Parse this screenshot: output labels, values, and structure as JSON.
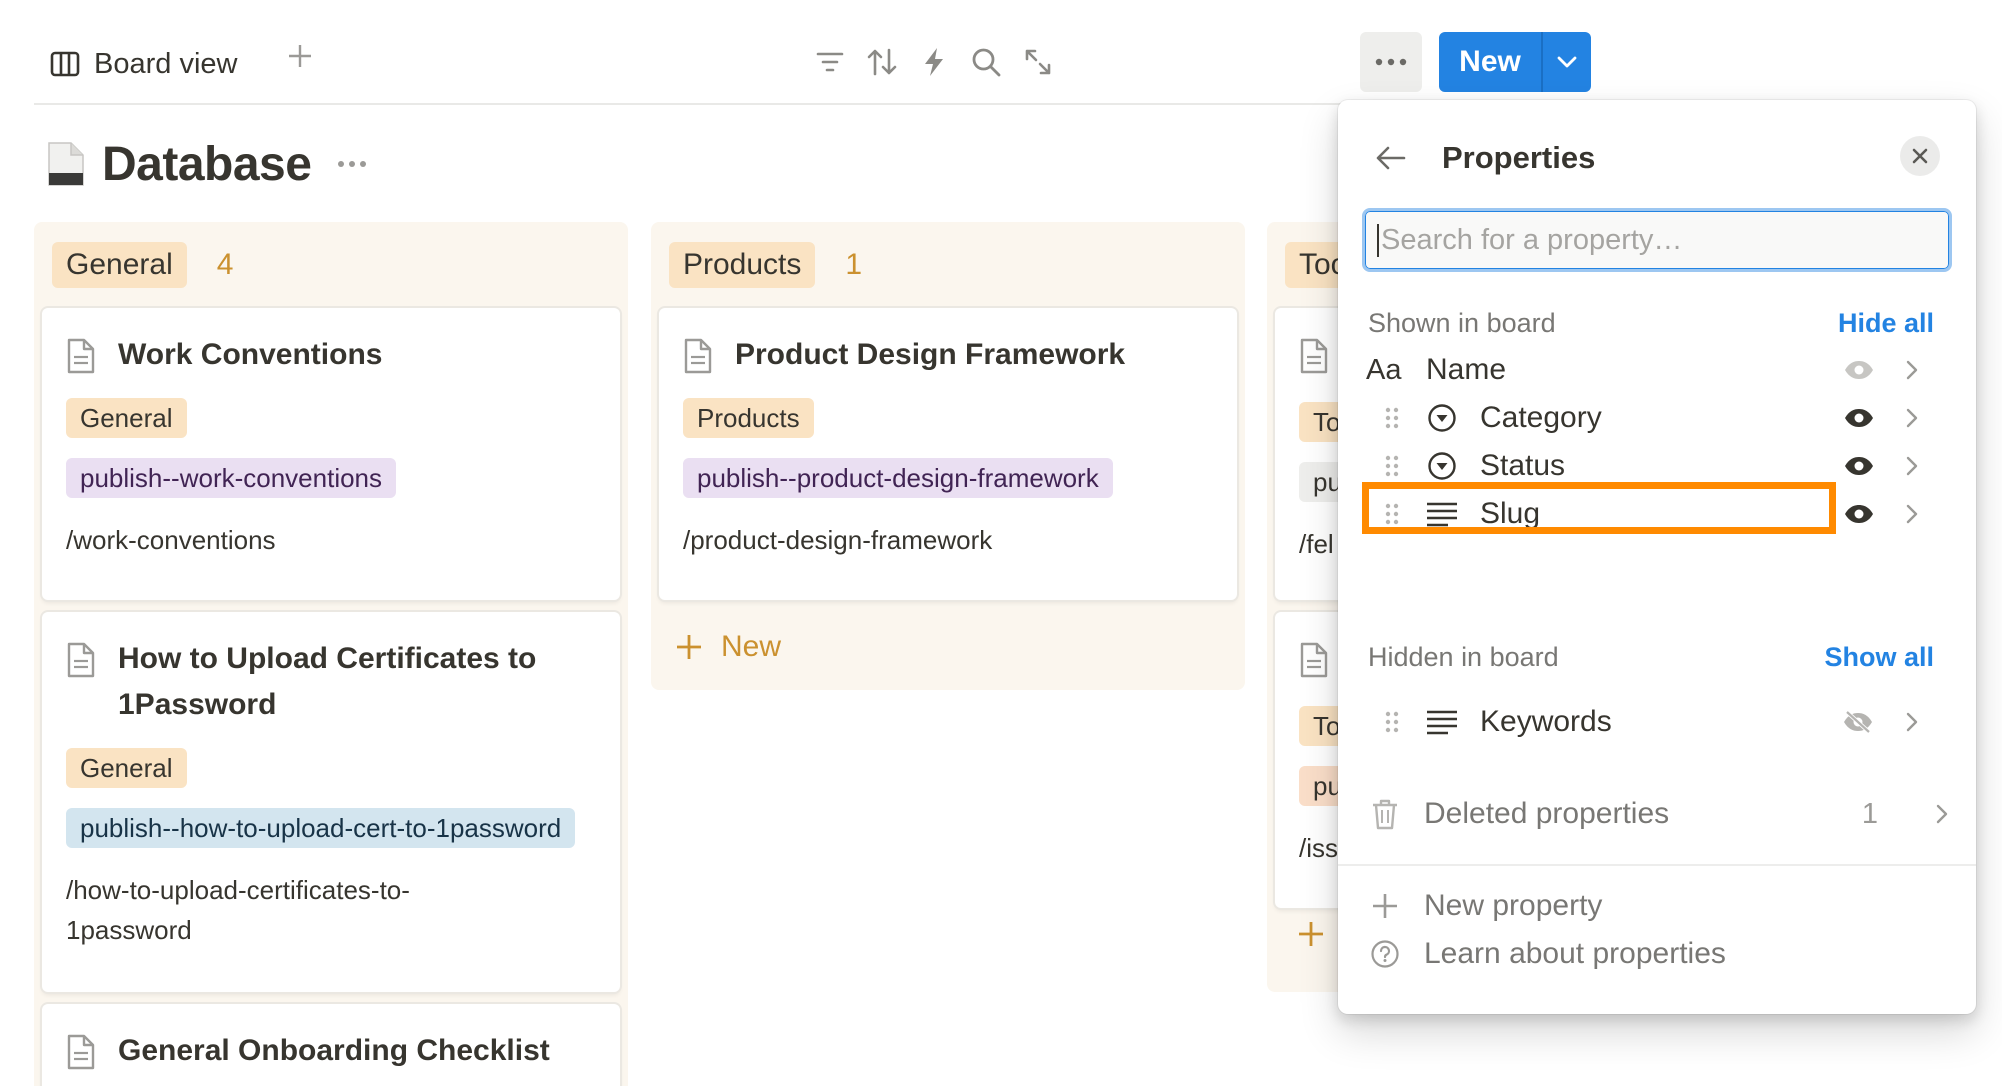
{
  "toolbar": {
    "view_label": "Board view",
    "new_label": "New"
  },
  "page": {
    "title": "Database"
  },
  "columns": [
    {
      "name": "General",
      "count": "4",
      "cards": [
        {
          "title": "Work Conventions",
          "category": "General",
          "status": "publish--work-conventions",
          "slug": "/work-conventions"
        },
        {
          "title": "How to Upload Certificates to 1Password",
          "category": "General",
          "status": "publish--how-to-upload-cert-to-1password",
          "slug": "/how-to-upload-certificates-to-1password"
        },
        {
          "title": "General Onboarding Checklist"
        }
      ]
    },
    {
      "name": "Products",
      "count": "1",
      "cards": [
        {
          "title": "Product Design Framework",
          "category": "Products",
          "status": "publish--product-design-framework",
          "slug": "/product-design-framework"
        }
      ],
      "add_label": "New"
    },
    {
      "name_visible": "Too",
      "card1": {
        "category": "To",
        "status": "pu",
        "slug": "/fel"
      },
      "card2": {
        "category": "To",
        "status": "pu",
        "slug": "/iss"
      }
    }
  ],
  "properties_panel": {
    "title": "Properties",
    "search_placeholder": "Search for a property…",
    "shown_label": "Shown in board",
    "hide_all": "Hide all",
    "hidden_label": "Hidden in board",
    "show_all": "Show all",
    "shown": [
      {
        "type_icon": "Aa",
        "name": "Name"
      },
      {
        "name": "Category"
      },
      {
        "name": "Status"
      },
      {
        "name": "Slug"
      }
    ],
    "hidden": [
      {
        "name": "Keywords"
      }
    ],
    "deleted_label": "Deleted properties",
    "deleted_count": "1",
    "new_property": "New property",
    "learn": "Learn about properties"
  },
  "colors": {
    "accent": "#2383e2",
    "highlight": "#ff8a00",
    "general_tag": "#fae3c3",
    "publish_tag": "#eadff2"
  }
}
